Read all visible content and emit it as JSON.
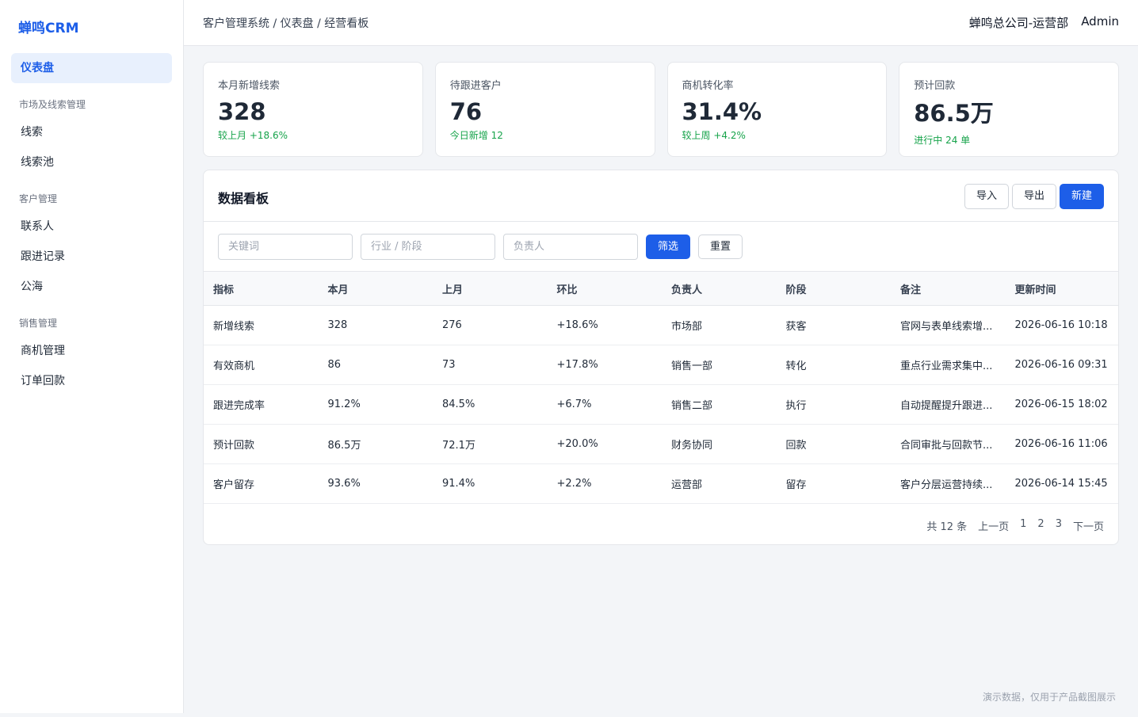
{
  "app": {
    "logo": "蝉鸣CRM"
  },
  "sidebar": {
    "active": "仪表盘",
    "groups": [
      {
        "title": "市场及线索管理",
        "items": [
          "线索",
          "线索池"
        ]
      },
      {
        "title": "客户管理",
        "items": [
          "联系人",
          "跟进记录",
          "公海"
        ]
      },
      {
        "title": "销售管理",
        "items": [
          "商机管理",
          "订单回款"
        ]
      }
    ]
  },
  "topbar": {
    "breadcrumb": "客户管理系统 / 仪表盘 / 经营看板",
    "org": "蝉鸣总公司-运营部",
    "user": "Admin"
  },
  "stats": [
    {
      "label": "本月新增线索",
      "value": "328",
      "sub": "较上月 +18.6%"
    },
    {
      "label": "待跟进客户",
      "value": "76",
      "sub": "今日新增 12"
    },
    {
      "label": "商机转化率",
      "value": "31.4%",
      "sub": "较上周 +4.2%"
    },
    {
      "label": "预计回款",
      "value": "86.5万",
      "sub": "进行中 24 单"
    }
  ],
  "panel": {
    "title": "数据看板",
    "actions": {
      "import": "导入",
      "export": "导出",
      "create": "新建"
    },
    "filters": {
      "keyword_placeholder": "关键词",
      "industry_placeholder": "行业 / 阶段",
      "owner_placeholder": "负责人",
      "filter_label": "筛选",
      "reset_label": "重置"
    },
    "columns": [
      "指标",
      "本月",
      "上月",
      "环比",
      "负责人",
      "阶段",
      "备注",
      "更新时间"
    ],
    "rows": [
      [
        "新增线索",
        "328",
        "276",
        "+18.6%",
        "市场部",
        "获客",
        "官网与表单线索增...",
        "2026-06-16 10:18"
      ],
      [
        "有效商机",
        "86",
        "73",
        "+17.8%",
        "销售一部",
        "转化",
        "重点行业需求集中...",
        "2026-06-16 09:31"
      ],
      [
        "跟进完成率",
        "91.2%",
        "84.5%",
        "+6.7%",
        "销售二部",
        "执行",
        "自动提醒提升跟进...",
        "2026-06-15 18:02"
      ],
      [
        "预计回款",
        "86.5万",
        "72.1万",
        "+20.0%",
        "财务协同",
        "回款",
        "合同审批与回款节...",
        "2026-06-16 11:06"
      ],
      [
        "客户留存",
        "93.6%",
        "91.4%",
        "+2.2%",
        "运营部",
        "留存",
        "客户分层运营持续...",
        "2026-06-14 15:45"
      ]
    ],
    "pagination": {
      "total": "共 12 条",
      "prev": "上一页",
      "pages": [
        "1",
        "2",
        "3"
      ],
      "next": "下一页"
    }
  },
  "footer": {
    "note": "演示数据，仅用于产品截图展示"
  }
}
